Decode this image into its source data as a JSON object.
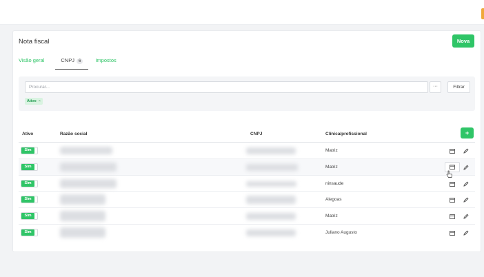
{
  "header": {
    "accent_color": "#f0a83a"
  },
  "card": {
    "title": "Nota fiscal",
    "new_button": "Nova"
  },
  "tabs": [
    {
      "label": "Visão geral",
      "active": false
    },
    {
      "label": "CNPJ",
      "badge": "6",
      "active": true
    },
    {
      "label": "Impostos",
      "active": false
    }
  ],
  "filters": {
    "search_placeholder": "Procurar...",
    "more_label": "···",
    "filter_button": "Filtrar",
    "chips": [
      {
        "label": "Ativo",
        "remove": "×"
      }
    ]
  },
  "table": {
    "columns": [
      "Ativo",
      "Razão social",
      "CNPJ",
      "Clínica/profissional"
    ],
    "add_button": "+",
    "rows": [
      {
        "ativo": "Sim",
        "clinica": "Matriz"
      },
      {
        "ativo": "Sim",
        "clinica": "Matriz"
      },
      {
        "ativo": "Sim",
        "clinica": "ninsaude"
      },
      {
        "ativo": "Sim",
        "clinica": "Alegoas"
      },
      {
        "ativo": "Sim",
        "clinica": "Matriz"
      },
      {
        "ativo": "Sim",
        "clinica": "Juliano Augusto"
      }
    ]
  },
  "colors": {
    "primary": "#2fc567",
    "chip_bg": "#d9f3e1"
  },
  "icons": {
    "row_action_1": "calendar-icon",
    "row_action_2": "pencil-icon",
    "cursor": "hand-pointer-icon"
  }
}
